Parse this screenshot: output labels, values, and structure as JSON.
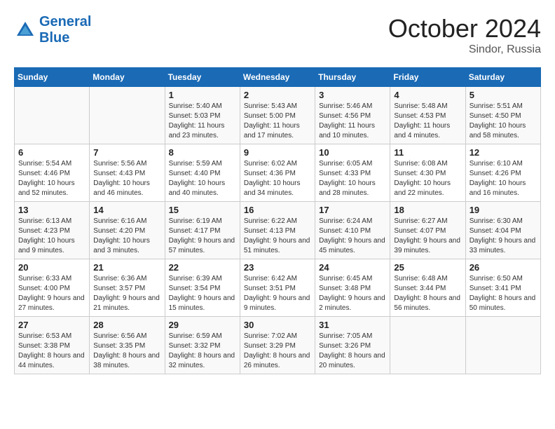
{
  "header": {
    "logo_line1": "General",
    "logo_line2": "Blue",
    "month": "October 2024",
    "location": "Sindor, Russia"
  },
  "weekdays": [
    "Sunday",
    "Monday",
    "Tuesday",
    "Wednesday",
    "Thursday",
    "Friday",
    "Saturday"
  ],
  "weeks": [
    [
      {
        "day": "",
        "info": ""
      },
      {
        "day": "",
        "info": ""
      },
      {
        "day": "1",
        "info": "Sunrise: 5:40 AM\nSunset: 5:03 PM\nDaylight: 11 hours\nand 23 minutes."
      },
      {
        "day": "2",
        "info": "Sunrise: 5:43 AM\nSunset: 5:00 PM\nDaylight: 11 hours\nand 17 minutes."
      },
      {
        "day": "3",
        "info": "Sunrise: 5:46 AM\nSunset: 4:56 PM\nDaylight: 11 hours\nand 10 minutes."
      },
      {
        "day": "4",
        "info": "Sunrise: 5:48 AM\nSunset: 4:53 PM\nDaylight: 11 hours\nand 4 minutes."
      },
      {
        "day": "5",
        "info": "Sunrise: 5:51 AM\nSunset: 4:50 PM\nDaylight: 10 hours\nand 58 minutes."
      }
    ],
    [
      {
        "day": "6",
        "info": "Sunrise: 5:54 AM\nSunset: 4:46 PM\nDaylight: 10 hours\nand 52 minutes."
      },
      {
        "day": "7",
        "info": "Sunrise: 5:56 AM\nSunset: 4:43 PM\nDaylight: 10 hours\nand 46 minutes."
      },
      {
        "day": "8",
        "info": "Sunrise: 5:59 AM\nSunset: 4:40 PM\nDaylight: 10 hours\nand 40 minutes."
      },
      {
        "day": "9",
        "info": "Sunrise: 6:02 AM\nSunset: 4:36 PM\nDaylight: 10 hours\nand 34 minutes."
      },
      {
        "day": "10",
        "info": "Sunrise: 6:05 AM\nSunset: 4:33 PM\nDaylight: 10 hours\nand 28 minutes."
      },
      {
        "day": "11",
        "info": "Sunrise: 6:08 AM\nSunset: 4:30 PM\nDaylight: 10 hours\nand 22 minutes."
      },
      {
        "day": "12",
        "info": "Sunrise: 6:10 AM\nSunset: 4:26 PM\nDaylight: 10 hours\nand 16 minutes."
      }
    ],
    [
      {
        "day": "13",
        "info": "Sunrise: 6:13 AM\nSunset: 4:23 PM\nDaylight: 10 hours\nand 9 minutes."
      },
      {
        "day": "14",
        "info": "Sunrise: 6:16 AM\nSunset: 4:20 PM\nDaylight: 10 hours\nand 3 minutes."
      },
      {
        "day": "15",
        "info": "Sunrise: 6:19 AM\nSunset: 4:17 PM\nDaylight: 9 hours\nand 57 minutes."
      },
      {
        "day": "16",
        "info": "Sunrise: 6:22 AM\nSunset: 4:13 PM\nDaylight: 9 hours\nand 51 minutes."
      },
      {
        "day": "17",
        "info": "Sunrise: 6:24 AM\nSunset: 4:10 PM\nDaylight: 9 hours\nand 45 minutes."
      },
      {
        "day": "18",
        "info": "Sunrise: 6:27 AM\nSunset: 4:07 PM\nDaylight: 9 hours\nand 39 minutes."
      },
      {
        "day": "19",
        "info": "Sunrise: 6:30 AM\nSunset: 4:04 PM\nDaylight: 9 hours\nand 33 minutes."
      }
    ],
    [
      {
        "day": "20",
        "info": "Sunrise: 6:33 AM\nSunset: 4:00 PM\nDaylight: 9 hours\nand 27 minutes."
      },
      {
        "day": "21",
        "info": "Sunrise: 6:36 AM\nSunset: 3:57 PM\nDaylight: 9 hours\nand 21 minutes."
      },
      {
        "day": "22",
        "info": "Sunrise: 6:39 AM\nSunset: 3:54 PM\nDaylight: 9 hours\nand 15 minutes."
      },
      {
        "day": "23",
        "info": "Sunrise: 6:42 AM\nSunset: 3:51 PM\nDaylight: 9 hours\nand 9 minutes."
      },
      {
        "day": "24",
        "info": "Sunrise: 6:45 AM\nSunset: 3:48 PM\nDaylight: 9 hours\nand 2 minutes."
      },
      {
        "day": "25",
        "info": "Sunrise: 6:48 AM\nSunset: 3:44 PM\nDaylight: 8 hours\nand 56 minutes."
      },
      {
        "day": "26",
        "info": "Sunrise: 6:50 AM\nSunset: 3:41 PM\nDaylight: 8 hours\nand 50 minutes."
      }
    ],
    [
      {
        "day": "27",
        "info": "Sunrise: 6:53 AM\nSunset: 3:38 PM\nDaylight: 8 hours\nand 44 minutes."
      },
      {
        "day": "28",
        "info": "Sunrise: 6:56 AM\nSunset: 3:35 PM\nDaylight: 8 hours\nand 38 minutes."
      },
      {
        "day": "29",
        "info": "Sunrise: 6:59 AM\nSunset: 3:32 PM\nDaylight: 8 hours\nand 32 minutes."
      },
      {
        "day": "30",
        "info": "Sunrise: 7:02 AM\nSunset: 3:29 PM\nDaylight: 8 hours\nand 26 minutes."
      },
      {
        "day": "31",
        "info": "Sunrise: 7:05 AM\nSunset: 3:26 PM\nDaylight: 8 hours\nand 20 minutes."
      },
      {
        "day": "",
        "info": ""
      },
      {
        "day": "",
        "info": ""
      }
    ]
  ]
}
